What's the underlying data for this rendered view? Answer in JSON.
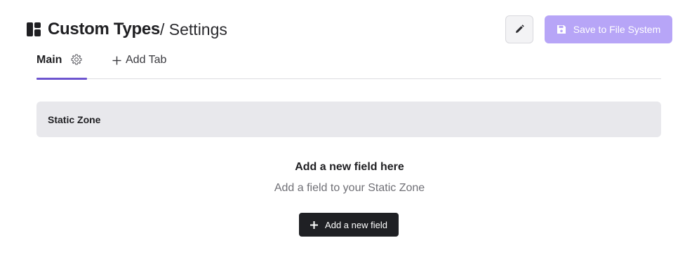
{
  "header": {
    "title": "Custom Types",
    "breadcrumb": "/ Settings",
    "edit_icon": "pencil-icon",
    "save_label": "Save to File System",
    "save_icon": "floppy-icon"
  },
  "tabs": {
    "items": [
      {
        "label": "Main",
        "icon": "gear-icon",
        "active": true
      }
    ],
    "add_label": "Add Tab"
  },
  "zone": {
    "label": "Static Zone"
  },
  "empty_state": {
    "title": "Add a new field here",
    "subtitle": "Add a field to your Static Zone",
    "button_label": "Add a new field"
  },
  "colors": {
    "accent": "#6d54cf",
    "save_button": "#b7a5f7",
    "dark_button": "#1f2024",
    "zone_bg": "#e8e8ec"
  }
}
